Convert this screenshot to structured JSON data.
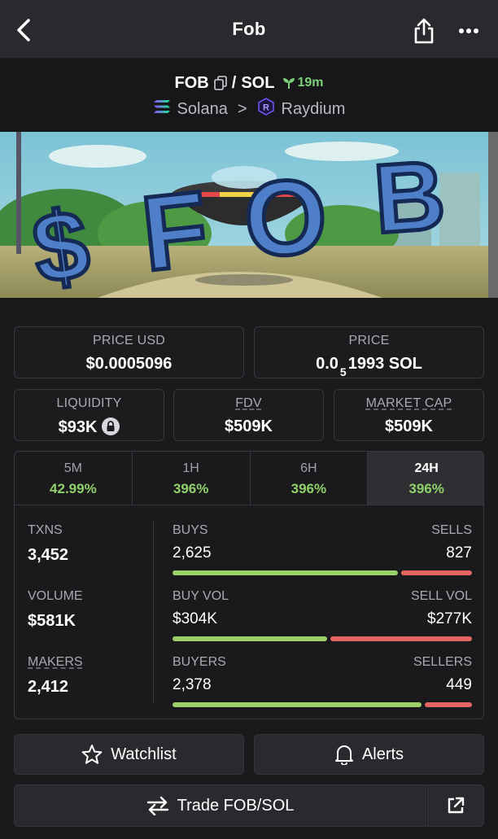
{
  "header": {
    "title": "Fob"
  },
  "pair": {
    "base": "FOB",
    "separator": "/",
    "quote": "SOL",
    "age": "19m",
    "chain": "Solana",
    "chevron": ">",
    "dex": "Raydium"
  },
  "banner": {
    "text": "$FOB"
  },
  "prices": {
    "price_usd_label": "PRICE USD",
    "price_usd_value": "$0.0005096",
    "price_label": "PRICE",
    "price_prefix": "0.0",
    "price_subscript": "5",
    "price_suffix": "1993 SOL"
  },
  "metrics": {
    "liquidity_label": "LIQUIDITY",
    "liquidity_value": "$93K",
    "fdv_label": "FDV",
    "fdv_value": "$509K",
    "mcap_label": "MARKET CAP",
    "mcap_value": "$509K"
  },
  "tabs": [
    {
      "label": "5M",
      "value": "42.99%"
    },
    {
      "label": "1H",
      "value": "396%"
    },
    {
      "label": "6H",
      "value": "396%"
    },
    {
      "label": "24H",
      "value": "396%",
      "active": true
    }
  ],
  "stats": {
    "txns_label": "TXNS",
    "txns_value": "3,452",
    "volume_label": "VOLUME",
    "volume_value": "$581K",
    "makers_label": "MAKERS",
    "makers_value": "2,412"
  },
  "bars": [
    {
      "left_label": "BUYS",
      "left_value": "2,625",
      "right_label": "SELLS",
      "right_value": "827",
      "buy_share": 0.76
    },
    {
      "left_label": "BUY VOL",
      "left_value": "$304K",
      "right_label": "SELL VOL",
      "right_value": "$277K",
      "buy_share": 0.523
    },
    {
      "left_label": "BUYERS",
      "left_value": "2,378",
      "right_label": "SELLERS",
      "right_value": "449",
      "buy_share": 0.841
    }
  ],
  "actions": {
    "watchlist_label": "Watchlist",
    "alerts_label": "Alerts",
    "trade_label": "Trade FOB/SOL"
  },
  "colors": {
    "positive": "#8fd16a",
    "buy_bar": "#9bd06b",
    "sell_bar": "#e56565"
  }
}
